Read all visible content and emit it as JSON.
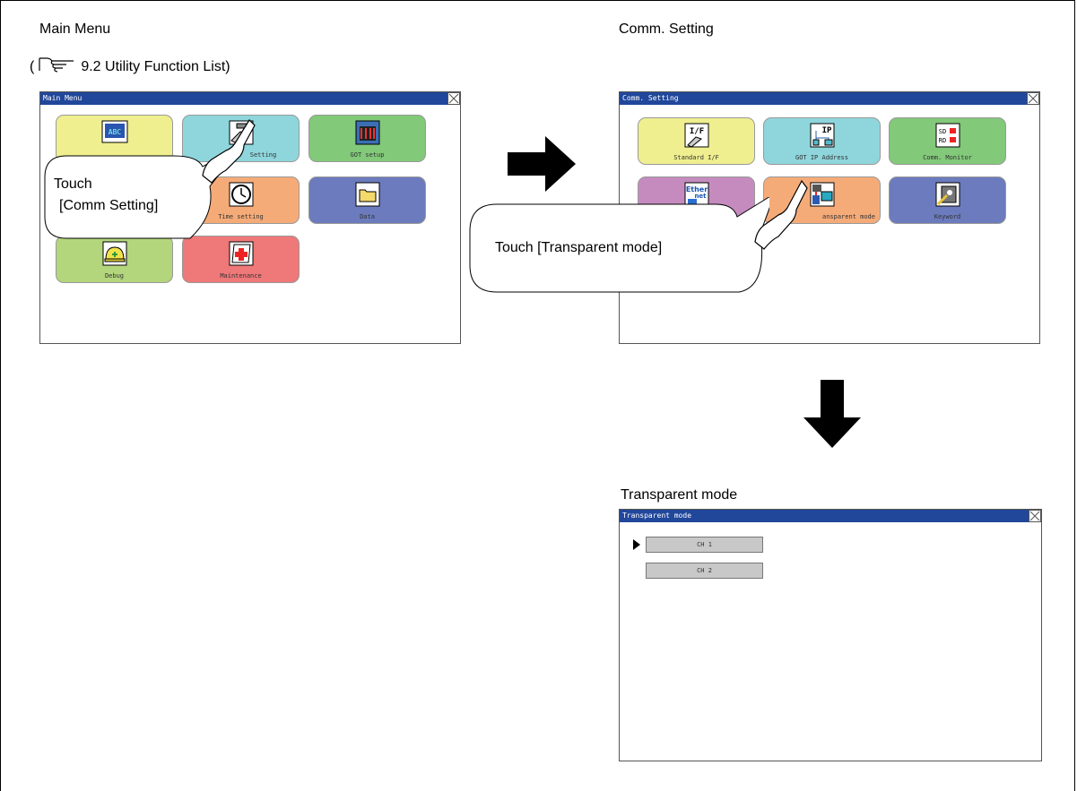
{
  "headings": {
    "main_menu": "Main Menu",
    "comm_setting": "Comm. Setting",
    "transparent_mode": "Transparent mode"
  },
  "reference": {
    "open": "(",
    "text": "9.2 Utility Function List)",
    "icon": "reference-hand-icon"
  },
  "main_menu_screen": {
    "title": "Main Menu",
    "tiles": [
      {
        "label": "",
        "icon": "abc-display-icon",
        "color": "#efef8f"
      },
      {
        "label": "Setting",
        "icon": "comm-setting-icon",
        "color": "#8ed6dc"
      },
      {
        "label": "GOT setup",
        "icon": "got-setup-icon",
        "color": "#82c97a"
      },
      {
        "label": "",
        "icon": "",
        "color": "#c58bbf"
      },
      {
        "label": "Time setting",
        "icon": "clock-icon",
        "color": "#f5ab78"
      },
      {
        "label": "Data",
        "icon": "folder-icon",
        "color": "#6b7bbd"
      },
      {
        "label": "Debug",
        "icon": "helmet-icon",
        "color": "#b3d57c"
      },
      {
        "label": "Maintenance",
        "icon": "first-aid-icon",
        "color": "#ef7878"
      }
    ],
    "callout": {
      "line1": "Touch",
      "line2": "[Comm Setting]"
    }
  },
  "comm_setting_screen": {
    "title": "Comm. Setting",
    "tiles": [
      {
        "label": "Standard I/F",
        "icon": "interface-icon",
        "color": "#efef8f"
      },
      {
        "label": "GOT IP Address",
        "icon": "ip-network-icon",
        "color": "#8ed6dc"
      },
      {
        "label": "Comm. Monitor",
        "icon": "sd-rd-icon",
        "color": "#82c97a"
      },
      {
        "label": "",
        "icon": "ethernet-icon",
        "color": "#c58bbf"
      },
      {
        "label": "ansparent mode",
        "icon": "transparent-mode-icon",
        "color": "#f5ab78"
      },
      {
        "label": "Keyword",
        "icon": "keyword-lock-icon",
        "color": "#6b7bbd"
      }
    ],
    "callout": {
      "text": "Touch [Transparent mode]"
    },
    "sd_label": "SD",
    "rd_label": "RD",
    "ip_label": "IP",
    "ether_label": "Ether",
    "net_label": "net"
  },
  "transparent_screen": {
    "title": "Transparent mode",
    "buttons": [
      "CH 1",
      "CH 2"
    ],
    "selected_index": 0
  }
}
